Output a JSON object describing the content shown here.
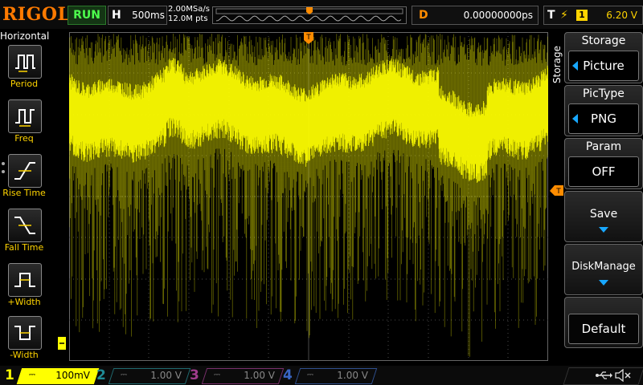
{
  "top": {
    "brand": "RIGOL",
    "run_state": "RUN",
    "horizontal": {
      "label": "H",
      "timebase": "500ms"
    },
    "sample_rate": "2.00MSa/s",
    "memory_depth": "12.0M pts",
    "delay": {
      "label": "D",
      "value": "0.00000000ps"
    },
    "trigger": {
      "label": "T",
      "source": "1",
      "level": "6.20 V"
    }
  },
  "left_menu": {
    "title": "Horizontal",
    "items": [
      {
        "label": "Period",
        "icon": "period-icon"
      },
      {
        "label": "Freq",
        "icon": "frequency-icon"
      },
      {
        "label": "Rise Time",
        "icon": "rise-time-icon"
      },
      {
        "label": "Fall Time",
        "icon": "fall-time-icon"
      },
      {
        "label": "+Width",
        "icon": "positive-width-icon"
      },
      {
        "label": "-Width",
        "icon": "negative-width-icon"
      }
    ]
  },
  "right_menu": {
    "title": "Storage",
    "vertical_title": "Storage",
    "picture": {
      "label": "Picture"
    },
    "pictype": {
      "title": "PicType",
      "value": "PNG"
    },
    "param": {
      "title": "Param",
      "value": "OFF"
    },
    "save": {
      "label": "Save"
    },
    "disk": {
      "label": "DiskManage"
    },
    "default": {
      "label": "Default"
    }
  },
  "channels": [
    {
      "number": "1",
      "scale": "100mV",
      "color": "#ffff00",
      "active": true
    },
    {
      "number": "2",
      "scale": "1.00 V",
      "color": "#22ccdd",
      "active": false
    },
    {
      "number": "3",
      "scale": "1.00 V",
      "color": "#e050c0",
      "active": false
    },
    {
      "number": "4",
      "scale": "1.00 V",
      "color": "#3f7fff",
      "active": false
    }
  ],
  "colors": {
    "trace": "#ffff00",
    "trigger_marker": "#ff8c00",
    "menu_arrow": "#18a8ff",
    "grid": "#4a4a4a"
  },
  "status_icons": [
    "usb-icon",
    "speaker-muted-icon"
  ]
}
